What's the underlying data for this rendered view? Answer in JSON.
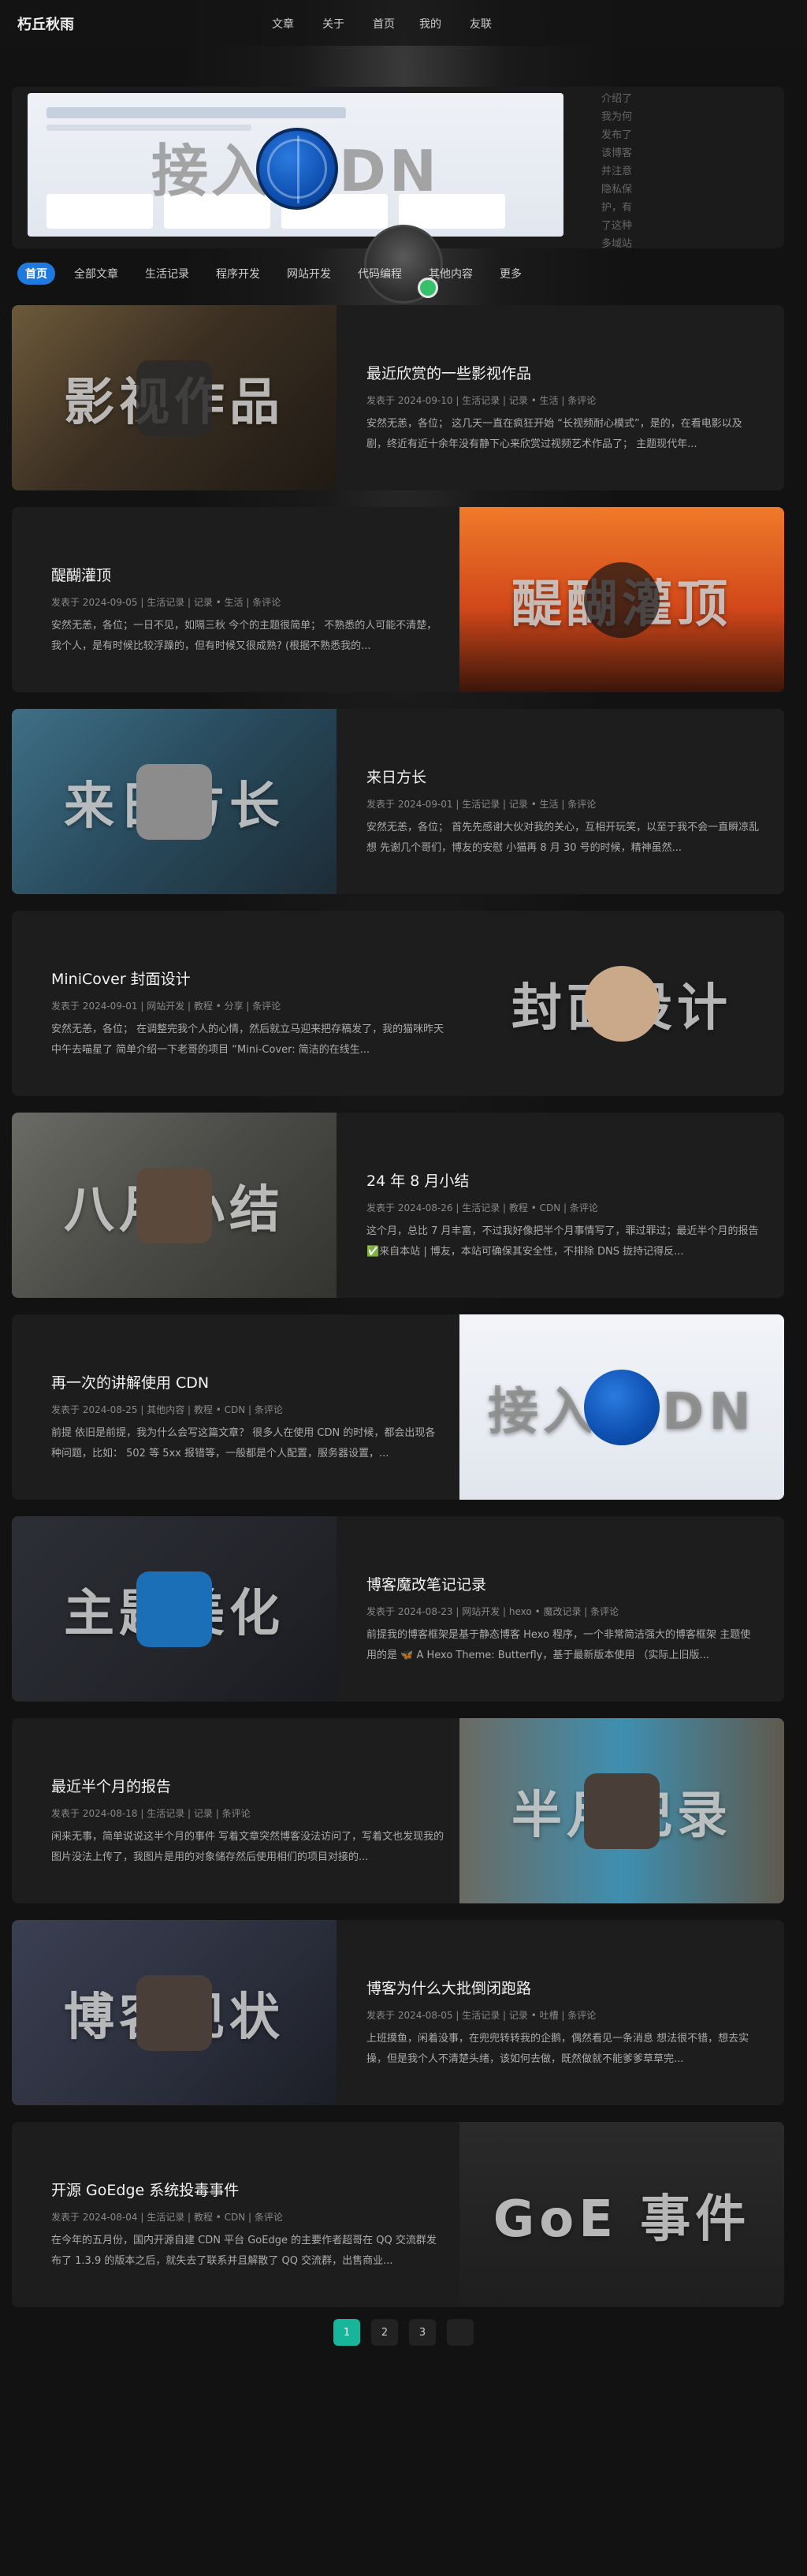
{
  "site": {
    "logo": "朽丘秋雨"
  },
  "nav": {
    "items": [
      {
        "label": "文章",
        "icon": "",
        "chev": ""
      },
      {
        "label": "关于",
        "icon": "",
        "chev": ""
      },
      {
        "label": "首页",
        "icon": "",
        "chev": ""
      },
      {
        "label": "我的",
        "icon": "",
        "chev": ""
      },
      {
        "label": "友联",
        "icon": "",
        "chev": ""
      }
    ],
    "search_icon": ""
  },
  "hero": {
    "image_text": "接入 CDN",
    "side_text": "介绍了我为何发布了该博客并注意隐私保护，有了这种多域站点的经验之后可以很清晰地查看"
  },
  "tabs": [
    {
      "label": "首页",
      "active": true
    },
    {
      "label": "全部文章"
    },
    {
      "label": "生活记录"
    },
    {
      "label": "程序开发"
    },
    {
      "label": "网站开发"
    },
    {
      "label": "代码编程"
    },
    {
      "label": "其他内容"
    },
    {
      "label": "更多"
    }
  ],
  "posts": [
    {
      "title": "最近欣赏的一些影视作品",
      "meta": "发表于 2024-09-10 | 生活记录 | 记录 • 生活 | 条评论",
      "excerpt": "安然无恙，各位； 这几天一直在疯狂开始 “长视频耐心模式”，是的，在看电影以及剧，终近有近十余年没有静下心来欣赏过视频艺术作品了； 主题现代年...",
      "thumb_text": "影视作品"
    },
    {
      "title": "醍醐灌顶",
      "meta": "发表于 2024-09-05 | 生活记录 | 记录 • 生活 | 条评论",
      "excerpt": "安然无恙，各位；一日不见，如隔三秋 今个的主题很简单； 不熟悉的人可能不清楚，我个人，是有时候比较浮躁的，但有时候又很成熟? (根据不熟悉我的...",
      "thumb_text": "醍醐灌顶"
    },
    {
      "title": "来日方长",
      "meta": "发表于 2024-09-01 | 生活记录 | 记录 • 生活 | 条评论",
      "excerpt": "安然无恙，各位； 首先先感谢大伙对我的关心，互相开玩笑，以至于我不会一直瞬凉乱想 先谢几个哥们，博友的安慰 小猫再 8 月 30 号的时候，精神虽然...",
      "thumb_text": "来日方长"
    },
    {
      "title": "MiniCover 封面设计",
      "meta": "发表于 2024-09-01 | 网站开发 | 教程 • 分享 | 条评论",
      "excerpt": "安然无恙，各位； 在调整完我个人的心情，然后就立马迎来把存稿发了，我的猫咪昨天中午去喵星了 简单介绍一下老哥的项目 “Mini-Cover: 简洁的在线生...",
      "thumb_text": "封面设计"
    },
    {
      "title": "24 年 8 月小结",
      "meta": "发表于 2024-08-26 | 生活记录 | 教程 • CDN | 条评论",
      "excerpt": "这个月，总比 7 月丰富，不过我好像把半个月事情写了，罪过罪过；最近半个月的报告 ✅来自本站 | 博友，本站可确保其安全性，不排除 DNS 拢持记得反...",
      "thumb_text": "八月小结"
    },
    {
      "title": "再一次的讲解使用 CDN",
      "meta": "发表于 2024-08-25 | 其他内容 | 教程 • CDN | 条评论",
      "excerpt": "前提 依旧是前提，我为什么会写这篇文章？ 很多人在使用 CDN 的时候，都会出现各种问题，比如： 502 等 5xx 报错等，一般都是个人配置，服务器设置，...",
      "thumb_text": "接入 CDN"
    },
    {
      "title": "博客魔改笔记记录",
      "meta": "发表于 2024-08-23 | 网站开发 | hexo • 魔改记录 | 条评论",
      "excerpt": "前提我的博客框架是基于静态博客 Hexo 程序，一个非常简洁强大的博客框架 主题使用的是 🦋 A Hexo Theme: Butterfly，基于最新版本使用 （实际上旧版...",
      "thumb_text": "主题美化"
    },
    {
      "title": "最近半个月的报告",
      "meta": "发表于 2024-08-18 | 生活记录 | 记录 | 条评论",
      "excerpt": "闲来无事，简单说说这半个月的事件 写着文章突然博客没法访问了，写着文也发现我的图片没法上传了，我图片是用的对象储存然后使用相们的项目对接的...",
      "thumb_text": "半月记录"
    },
    {
      "title": "博客为什么大批倒闭跑路",
      "meta": "发表于 2024-08-05 | 生活记录 | 记录 • 吐槽 | 条评论",
      "excerpt": "上班摸鱼，闲着没事，在兜兜转转我的企鹅，偶然看见一条消息 想法很不错，想去实操，但是我个人不清楚头绪，该如何去做，既然做就不能爹爹草草完...",
      "thumb_text": "博客现状"
    },
    {
      "title": "开源 GoEdge 系统投毒事件",
      "meta": "发表于 2024-08-04 | 生活记录 | 教程 • CDN | 条评论",
      "excerpt": "在今年的五月份，国内开源自建 CDN 平台 GoEdge 的主要作者超哥在 QQ 交流群发布了 1.3.9 的版本之后，就失去了联系并且解散了 QQ 交流群，出售商业...",
      "thumb_text": "GoE 事件"
    }
  ],
  "pagination": {
    "pages": [
      "1",
      "2",
      "3"
    ],
    "next": "",
    "active": "1"
  },
  "colors": {
    "accent": "#1f7ae0",
    "page_active": "#17b59a",
    "online": "#37c06b"
  }
}
